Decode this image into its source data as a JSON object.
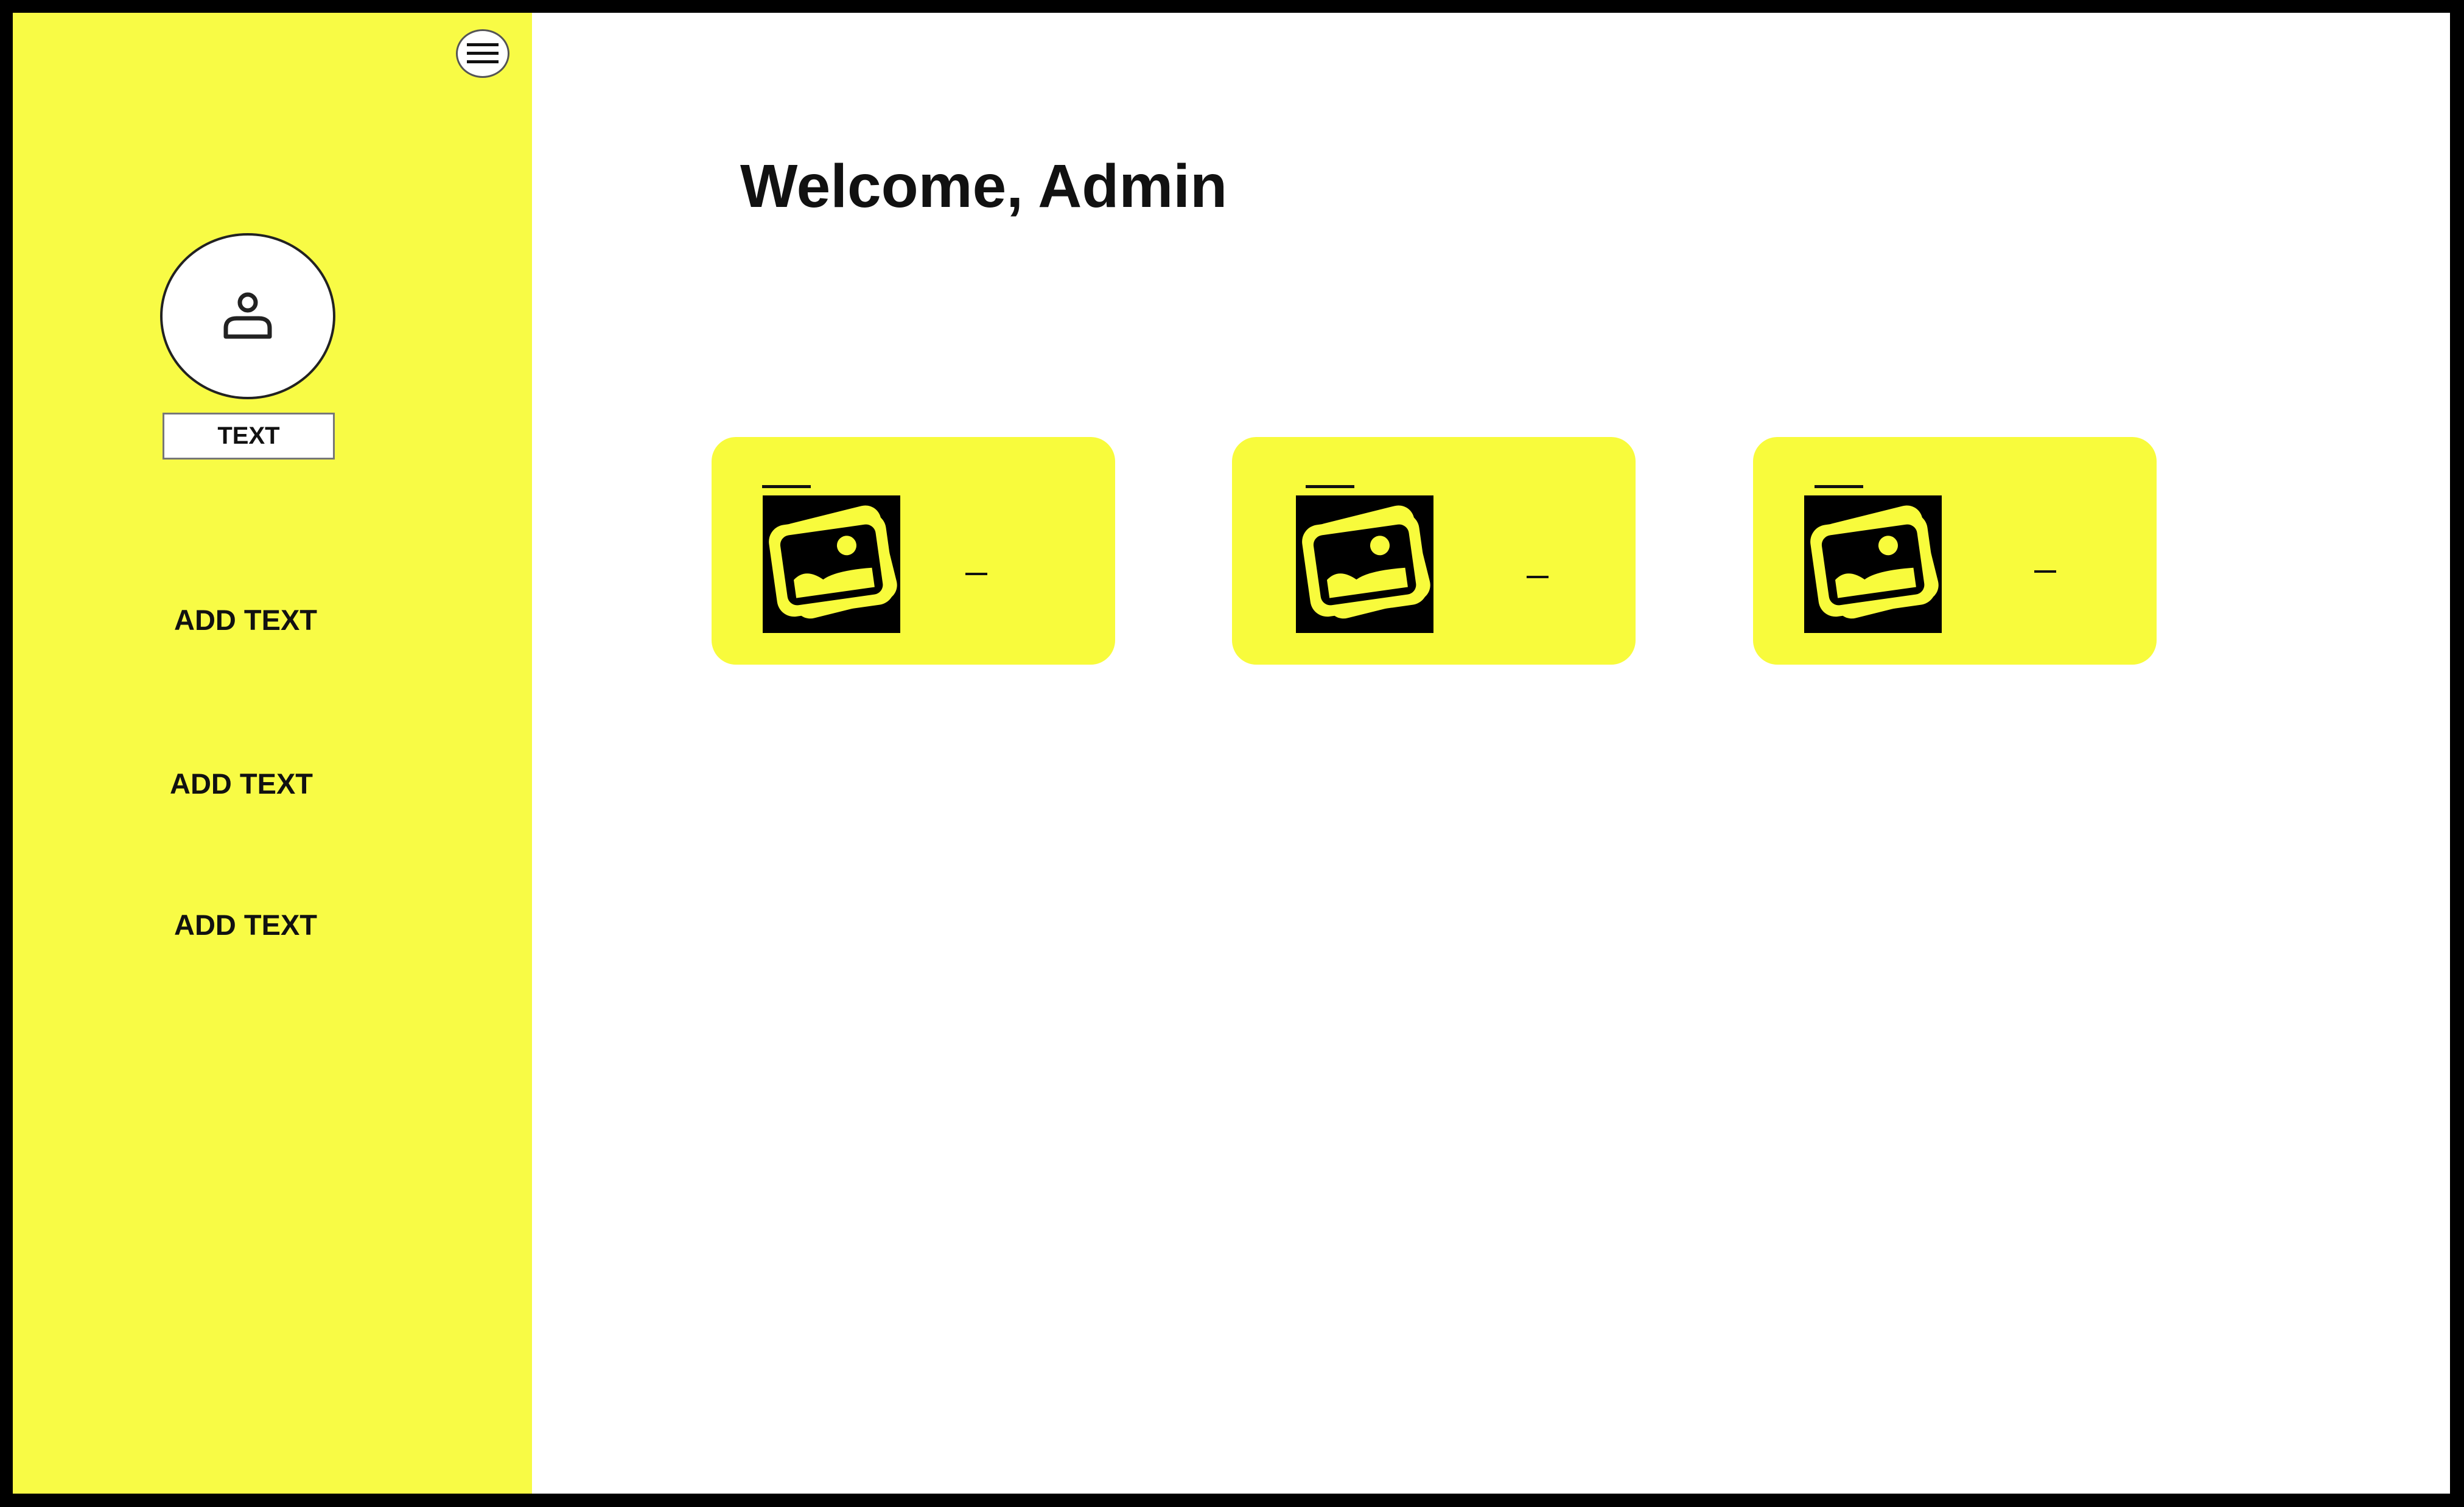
{
  "sidebar": {
    "menu_icon": "hamburger-menu-icon",
    "avatar_icon": "user-icon",
    "name_label": "TEXT",
    "items": [
      {
        "label": "ADD TEXT"
      },
      {
        "label": "ADD TEXT"
      },
      {
        "label": "ADD TEXT"
      }
    ]
  },
  "main": {
    "welcome": "Welcome, Admin",
    "cards": [
      {
        "icon": "image-icon",
        "detail": "_"
      },
      {
        "icon": "image-icon",
        "detail": "_"
      },
      {
        "icon": "image-icon",
        "detail": "_"
      }
    ]
  },
  "colors": {
    "sidebar_bg": "#f8fb45",
    "card_bg": "#f8fb3c",
    "frame_border": "#000000",
    "text": "#111111"
  }
}
